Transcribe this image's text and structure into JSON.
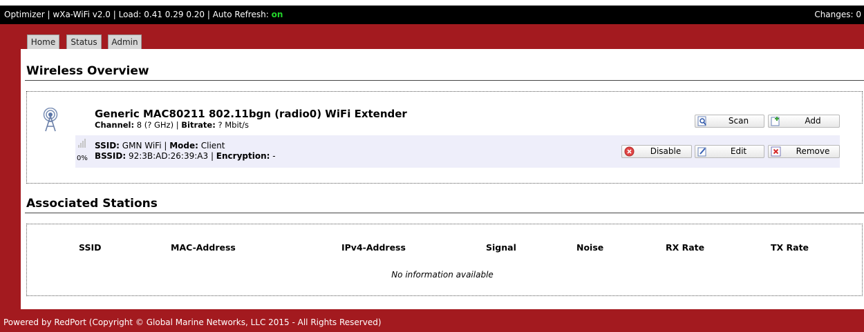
{
  "topbar": {
    "prefix": "Optimizer | wXa-WiFi v2.0 | Load: 0.41 0.29 0.20 | Auto Refresh: ",
    "auto_refresh": "on",
    "changes": "Changes: 0"
  },
  "tabs": [
    "Home",
    "Status",
    "Admin"
  ],
  "wireless_overview": {
    "title": "Wireless Overview",
    "radio": {
      "name": "Generic MAC80211 802.11bgn (radio0) WiFi Extender",
      "channel_label": "Channel:",
      "channel_value": " 8 (? GHz) | ",
      "bitrate_label": "Bitrate:",
      "bitrate_value": " ? Mbit/s",
      "scan_label": "Scan",
      "add_label": "Add"
    },
    "network": {
      "ssid_label": "SSID:",
      "ssid_value": " GMN WiFi | ",
      "mode_label": "Mode:",
      "mode_value": " Client",
      "bssid_label": "BSSID:",
      "bssid_value": " 92:3B:AD:26:39:A3 | ",
      "encryption_label": "Encryption:",
      "encryption_value": " -",
      "signal_percent": "0%",
      "disable_label": "Disable",
      "edit_label": "Edit",
      "remove_label": "Remove"
    }
  },
  "associated_stations": {
    "title": "Associated Stations",
    "columns": [
      "SSID",
      "MAC-Address",
      "IPv4-Address",
      "Signal",
      "Noise",
      "RX Rate",
      "TX Rate"
    ],
    "empty_text": "No information available"
  },
  "footer": "Powered by RedPort (Copyright © Global Marine Networks, LLC 2015 - All Rights Reserved)",
  "colors": {
    "frame": "#a31a1f",
    "topbar": "#000000",
    "on": "#22d32a",
    "row": "#eeeefa"
  }
}
